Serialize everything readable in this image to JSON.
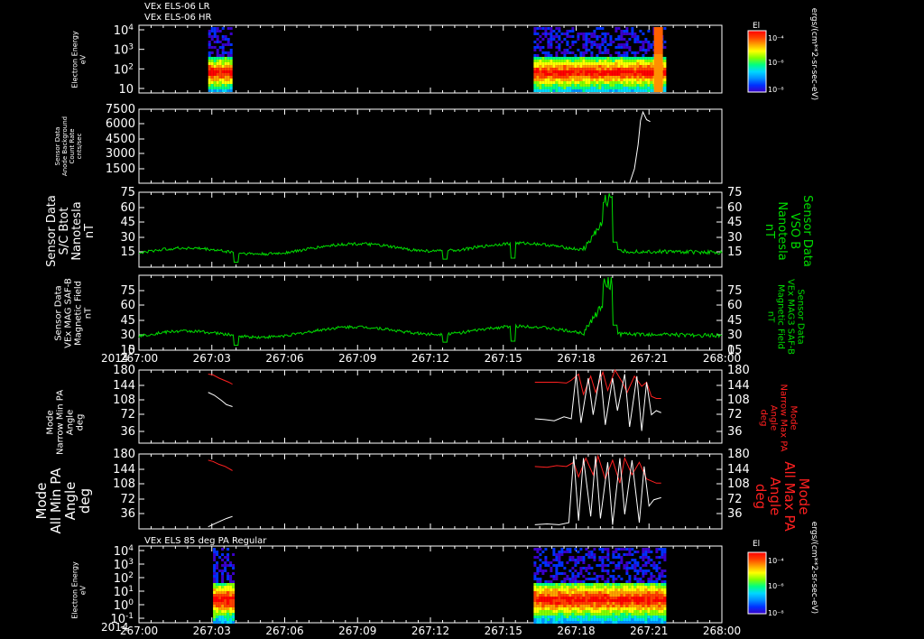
{
  "titles": {
    "top_line1": "VEx ELS-06 LR",
    "top_line2": "VEx ELS-06 HR",
    "bottom": "VEx ELS 85 deg PA Regular"
  },
  "colorbar": {
    "title": "El",
    "units": "ergs/(cm**2-sr-sec-eV)",
    "ticks": [
      "10⁻⁴",
      "10⁻⁶",
      "10⁻⁸"
    ]
  },
  "panels": [
    {
      "id": "p1",
      "left_label": [
        "Electron Energy",
        "eV"
      ],
      "right_label": []
    },
    {
      "id": "p2",
      "left_label": [
        "Sensor Data",
        "Anode Background",
        "Count Rate",
        "cnts/sec"
      ],
      "right_label": []
    },
    {
      "id": "p3",
      "left_label": [
        "Sensor Data",
        "S/C Btot",
        "Nanotesla",
        "nT"
      ],
      "right_label": [
        "Sensor Data",
        "VSO B",
        "Nanotesla",
        "nT"
      ]
    },
    {
      "id": "p4",
      "left_label": [
        "Sensor Data",
        "VEx MAG SAF-B",
        "Magnetic Field",
        "nT"
      ],
      "right_label": [
        "Sensor Data",
        "VEx MAG3 SAF-B",
        "Magnetic Field",
        "nT"
      ]
    },
    {
      "id": "p5",
      "left_label": [
        "Mode",
        "Narrow Min PA",
        "Angle",
        "deg"
      ],
      "right_label": [
        "Mode",
        "Narrow Max PA",
        "Angle",
        "deg"
      ]
    },
    {
      "id": "p6",
      "left_label": [
        "Mode",
        "All Min PA",
        "Angle",
        "deg"
      ],
      "right_label": [
        "Mode",
        "All Max PA",
        "Angle",
        "deg"
      ]
    },
    {
      "id": "p7",
      "left_label": [
        "Electron Energy",
        "eV"
      ],
      "right_label": []
    }
  ],
  "time_axis": {
    "year": "2014",
    "ticks": [
      "267:00",
      "267:03",
      "267:06",
      "267:09",
      "267:12",
      "267:15",
      "267:18",
      "267:21",
      "268:00"
    ]
  },
  "colors": {
    "green": "#00dd00",
    "red": "#ff2020",
    "white": "#ffffff"
  },
  "chart_data": [
    {
      "type": "heatmap",
      "name": "p1",
      "ylog": true,
      "ylim": [
        1,
        20000
      ],
      "yticks": [
        {
          "base": "10",
          "exp": "4"
        },
        {
          "base": "10",
          "exp": "3"
        },
        {
          "base": "10",
          "exp": "2"
        },
        {
          "base": "10",
          "exp": ""
        }
      ],
      "blocks": [
        {
          "t0": 2.85,
          "t1": 3.85
        },
        {
          "t0": 16.25,
          "t1": 21.6
        }
      ]
    },
    {
      "type": "line",
      "name": "p2",
      "ylim": [
        0,
        7500
      ],
      "yticks": [
        "7500",
        "6000",
        "4500",
        "3000",
        "1500"
      ],
      "x": [
        20.2,
        20.4,
        20.55,
        20.65,
        20.75,
        20.9,
        21.05
      ],
      "y": [
        0,
        1500,
        4000,
        6500,
        7400,
        6600,
        6400
      ]
    },
    {
      "type": "line",
      "name": "p3",
      "ylim": [
        0,
        75
      ],
      "yticks": [
        "75",
        "60",
        "45",
        "30",
        "15"
      ],
      "right_yticks": [
        "75",
        "60",
        "45",
        "30",
        "15"
      ]
    },
    {
      "type": "line",
      "name": "p4",
      "ylim": [
        0,
        75
      ],
      "yticks": [
        "75",
        "60",
        "45",
        "30",
        "15",
        "0"
      ],
      "right_yticks": [
        "75",
        "60",
        "45",
        "30",
        "15",
        "0"
      ]
    },
    {
      "type": "line",
      "name": "p5",
      "ylim": [
        0,
        180
      ],
      "yticks": [
        "180",
        "144",
        "108",
        "72",
        "36"
      ],
      "right_yticks": [
        "180",
        "144",
        "108",
        "72",
        "36"
      ],
      "max_pa": [
        {
          "x": [
            2.85,
            3.05,
            3.3,
            3.5,
            3.7,
            3.85
          ],
          "y": [
            170,
            168,
            160,
            155,
            150,
            145
          ]
        },
        {
          "x": [
            16.3,
            16.8,
            17.2,
            17.6,
            17.8,
            18.1,
            18.3,
            18.6,
            18.8,
            19.1,
            19.3,
            19.6,
            19.9,
            20.1,
            20.4,
            20.7,
            20.9,
            21.1,
            21.3,
            21.5
          ],
          "y": [
            150,
            150,
            150,
            148,
            155,
            170,
            120,
            165,
            125,
            175,
            130,
            180,
            150,
            125,
            165,
            140,
            150,
            115,
            110,
            110
          ]
        }
      ],
      "min_pa": [
        {
          "x": [
            2.85,
            3.1,
            3.4,
            3.6,
            3.85
          ],
          "y": [
            125,
            118,
            105,
            95,
            90
          ]
        },
        {
          "x": [
            16.3,
            16.7,
            17.1,
            17.5,
            17.8,
            18.0,
            18.2,
            18.5,
            18.7,
            19.0,
            19.2,
            19.5,
            19.7,
            20.0,
            20.2,
            20.5,
            20.7,
            20.9,
            21.1,
            21.3,
            21.5
          ],
          "y": [
            60,
            58,
            55,
            65,
            60,
            170,
            50,
            160,
            70,
            175,
            45,
            160,
            80,
            170,
            40,
            165,
            30,
            150,
            70,
            80,
            75
          ]
        }
      ]
    },
    {
      "type": "line",
      "name": "p6",
      "ylim": [
        0,
        180
      ],
      "yticks": [
        "180",
        "144",
        "108",
        "72",
        "36"
      ],
      "right_yticks": [
        "180",
        "144",
        "108",
        "72",
        "36"
      ],
      "max_pa": [
        {
          "x": [
            2.85,
            3.05,
            3.3,
            3.55,
            3.85
          ],
          "y": [
            165,
            162,
            155,
            150,
            140
          ]
        },
        {
          "x": [
            16.3,
            16.8,
            17.2,
            17.6,
            17.9,
            18.1,
            18.4,
            18.7,
            18.9,
            19.2,
            19.5,
            19.8,
            20.0,
            20.3,
            20.6,
            20.9,
            21.1,
            21.3,
            21.5
          ],
          "y": [
            150,
            148,
            152,
            150,
            160,
            125,
            170,
            130,
            175,
            120,
            165,
            110,
            170,
            130,
            160,
            120,
            115,
            110,
            110
          ]
        }
      ],
      "min_pa": [
        {
          "x": [
            2.85,
            3.1,
            3.4,
            3.6,
            3.85
          ],
          "y": [
            5,
            12,
            20,
            25,
            30
          ]
        },
        {
          "x": [
            16.3,
            16.8,
            17.3,
            17.7,
            17.9,
            18.1,
            18.3,
            18.6,
            18.8,
            19.0,
            19.3,
            19.5,
            19.8,
            20.0,
            20.3,
            20.6,
            20.8,
            21.0,
            21.2,
            21.5
          ],
          "y": [
            10,
            12,
            10,
            15,
            175,
            20,
            170,
            30,
            175,
            25,
            160,
            10,
            170,
            35,
            165,
            15,
            150,
            55,
            70,
            75
          ]
        }
      ]
    },
    {
      "type": "heatmap",
      "name": "p7",
      "ylog": true,
      "ylim": [
        0.1,
        20000
      ],
      "yticks": [
        {
          "base": "10",
          "exp": "4"
        },
        {
          "base": "10",
          "exp": "3"
        },
        {
          "base": "10",
          "exp": "2"
        },
        {
          "base": "10",
          "exp": "1"
        },
        {
          "base": "10",
          "exp": "0"
        },
        {
          "base": "10",
          "exp": "-1"
        }
      ],
      "blocks": [
        {
          "t0": 3.05,
          "t1": 3.85
        },
        {
          "t0": 16.25,
          "t1": 21.6
        }
      ]
    }
  ]
}
